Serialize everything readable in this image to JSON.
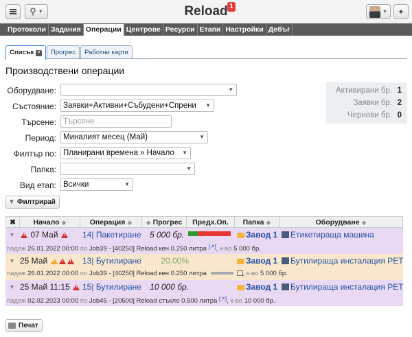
{
  "app": {
    "title": "Reload",
    "badge": "1"
  },
  "nav": [
    "Протоколи",
    "Задания",
    "Операции",
    "Центрове",
    "Ресурси",
    "Етапи",
    "Настройки",
    "Дебъг"
  ],
  "subtabs": [
    "Списък",
    "Прогрес",
    "Работни карти"
  ],
  "page_title": "Производствени операции",
  "filters": {
    "equipment_label": "Оборудване:",
    "equipment_value": "",
    "state_label": "Състояние:",
    "state_value": "Заявки+Активни+Събудени+Спрени",
    "search_label": "Търсене:",
    "search_placeholder": "Търсене",
    "period_label": "Период:",
    "period_value": "Миналият месец (Май)",
    "filterby_label": "Филтър по:",
    "filterby_value": "Планирани времена » Начало",
    "folder_label": "Папка:",
    "folder_value": "",
    "stage_label": "Вид етап:",
    "stage_value": "Всички",
    "filter_button": "Филтрирай"
  },
  "stats": [
    {
      "label": "Активирани бр.",
      "value": "1"
    },
    {
      "label": "Заявки бр.",
      "value": "2"
    },
    {
      "label": "Чернови бр.",
      "value": "0"
    }
  ],
  "table": {
    "headers": {
      "start": "Начало",
      "operation": "Операция",
      "progress": "Прогрес",
      "prev_op": "Предх.Оп.",
      "folder": "Папка",
      "equipment": "Оборудване"
    },
    "rows": [
      {
        "start": "07 Май",
        "op_id": "14",
        "op_name": "Пакетиране",
        "progress": "5 000 бр.",
        "folder": "Завод 1",
        "equipment": "Етикетираща машина",
        "sub_label": "падеж",
        "sub_date": "26.01.2022 00:00",
        "sub_by": "по",
        "sub_job": "Job39 - [40250] Reload кен 0.250 литра",
        "sub_ext": "[↗]",
        "sub_qty_label": "к-во",
        "sub_qty": "5 000 бр."
      },
      {
        "start": "25 Май",
        "op_id": "13",
        "op_name": "Бутилиране",
        "progress": "20.00%",
        "folder": "Завод 1",
        "equipment": "Бутилираща инсталация PET",
        "sub_label": "падеж",
        "sub_date": "26.01.2022 00:00",
        "sub_by": "по",
        "sub_job": "Job39 - [40250] Reload кен 0.250 литра",
        "sub_qty_label": "к-во",
        "sub_qty": "5 000 бр."
      },
      {
        "start": "25 Май 11:15",
        "op_id": "15",
        "op_name": "Бутилиране",
        "progress": "10 000 бр.",
        "folder": "Завод 1",
        "equipment": "Бутилираща инсталация PET",
        "sub_label": "падеж",
        "sub_date": "02.02.2023 00:00",
        "sub_by": "по",
        "sub_job": "Job45 - [20500] Reload стъкло 0.500 литра",
        "sub_ext": "[↗]",
        "sub_qty_label": "к-во",
        "sub_qty": "10 000 бр."
      }
    ]
  },
  "print_button": "Печат"
}
